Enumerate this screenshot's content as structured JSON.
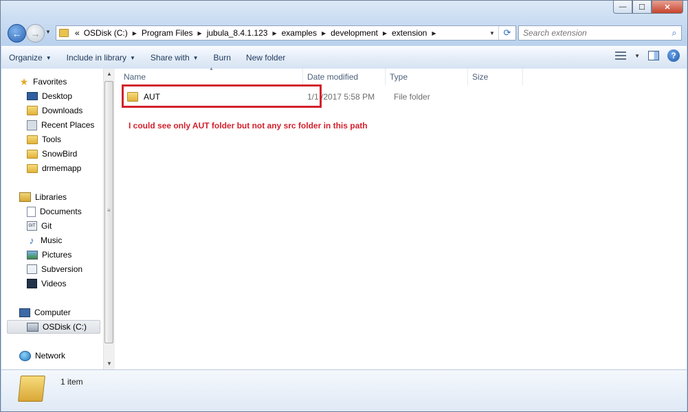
{
  "window": {
    "title_controls": {
      "minimize": "—",
      "maximize": "☐",
      "close": "✕"
    }
  },
  "nav": {
    "back_icon": "arrow-left-icon",
    "forward_icon": "arrow-right-icon",
    "breadcrumbs": [
      "OSDisk (C:)",
      "Program Files",
      "jubula_8.4.1.123",
      "examples",
      "development",
      "extension"
    ],
    "overflow_marker": "«",
    "search_placeholder": "Search extension"
  },
  "toolbar": {
    "organize": "Organize",
    "include_in_library": "Include in library",
    "share_with": "Share with",
    "burn": "Burn",
    "new_folder": "New folder"
  },
  "sidebar": {
    "favorites": {
      "label": "Favorites",
      "items": [
        {
          "label": "Desktop",
          "icon": "desktop-icon"
        },
        {
          "label": "Downloads",
          "icon": "downloads-folder-icon"
        },
        {
          "label": "Recent Places",
          "icon": "recent-places-icon"
        },
        {
          "label": "Tools",
          "icon": "folder-icon"
        },
        {
          "label": "SnowBird",
          "icon": "folder-icon"
        },
        {
          "label": "drmemapp",
          "icon": "folder-icon"
        }
      ]
    },
    "libraries": {
      "label": "Libraries",
      "items": [
        {
          "label": "Documents",
          "icon": "documents-icon"
        },
        {
          "label": "Git",
          "icon": "git-icon"
        },
        {
          "label": "Music",
          "icon": "music-icon"
        },
        {
          "label": "Pictures",
          "icon": "pictures-icon"
        },
        {
          "label": "Subversion",
          "icon": "subversion-icon"
        },
        {
          "label": "Videos",
          "icon": "videos-icon"
        }
      ]
    },
    "computer": {
      "label": "Computer",
      "items": [
        {
          "label": "OSDisk (C:)",
          "icon": "disk-icon",
          "selected": true
        }
      ]
    },
    "network": {
      "label": "Network"
    }
  },
  "columns": {
    "name": "Name",
    "date": "Date modified",
    "type": "Type",
    "size": "Size"
  },
  "files": [
    {
      "name": "AUT",
      "date": "1/1 /2017 5:58 PM",
      "type": "File folder",
      "size": ""
    }
  ],
  "annotation": {
    "text": "I could see only AUT folder but not any src folder in this path",
    "color": "#d3202b"
  },
  "details": {
    "count": "1 item"
  }
}
